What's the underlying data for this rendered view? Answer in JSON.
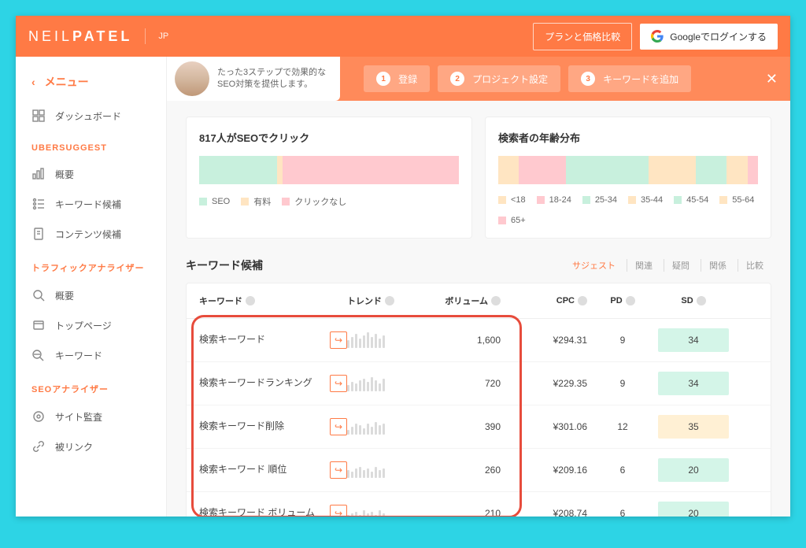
{
  "topbar": {
    "logo_light": "NEIL",
    "logo_bold": "PATEL",
    "lang": "JP",
    "plan_button": "プランと価格比較",
    "google_button": "Googleでログインする"
  },
  "sidebar": {
    "menu_label": "メニュー",
    "dashboard": "ダッシュボード",
    "section_ubersuggest": "UBERSUGGEST",
    "overview": "概要",
    "keyword_ideas": "キーワード候補",
    "content_ideas": "コンテンツ候補",
    "section_traffic": "トラフィックアナライザー",
    "traffic_overview": "概要",
    "top_pages": "トップページ",
    "keywords": "キーワード",
    "section_seo": "SEOアナライザー",
    "site_audit": "サイト監査",
    "backlinks": "被リンク"
  },
  "promo": {
    "line1": "たった3ステップで効果的な",
    "line2": "SEO対策を提供します。",
    "step1": "登録",
    "step2": "プロジェクト設定",
    "step3": "キーワードを追加"
  },
  "card_clicks": {
    "title": "817人がSEOでクリック",
    "legend": [
      "SEO",
      "有料",
      "クリックなし"
    ],
    "colors": [
      "#c8f0dd",
      "#ffe5c2",
      "#ffc9cf"
    ],
    "segments": [
      30,
      2,
      68
    ]
  },
  "card_age": {
    "title": "検索者の年齢分布",
    "legend": [
      "<18",
      "18-24",
      "25-34",
      "35-44",
      "45-54",
      "55-64",
      "65+"
    ],
    "colors": [
      "#ffe5c2",
      "#ffc9cf",
      "#c8f0dd",
      "#ffe5c2",
      "#c8f0dd",
      "#ffe5c2",
      "#ffc9cf"
    ],
    "segments": [
      8,
      18,
      32,
      18,
      12,
      8,
      4
    ]
  },
  "keyword_section": {
    "title": "キーワード候補",
    "tabs": [
      "サジェスト",
      "関連",
      "疑問",
      "関係",
      "比較"
    ]
  },
  "table": {
    "headers": {
      "keyword": "キーワード",
      "trend": "トレンド",
      "volume": "ボリューム",
      "cpc": "CPC",
      "pd": "PD",
      "sd": "SD"
    },
    "rows": [
      {
        "keyword": "検索キーワード",
        "volume": "1,600",
        "cpc": "¥294.31",
        "pd": "9",
        "sd": "34",
        "sd_class": "sd-green"
      },
      {
        "keyword": "検索キーワードランキング",
        "volume": "720",
        "cpc": "¥229.35",
        "pd": "9",
        "sd": "34",
        "sd_class": "sd-green"
      },
      {
        "keyword": "検索キーワード削除",
        "volume": "390",
        "cpc": "¥301.06",
        "pd": "12",
        "sd": "35",
        "sd_class": "sd-yellow"
      },
      {
        "keyword": "検索キーワード 順位",
        "volume": "260",
        "cpc": "¥209.16",
        "pd": "6",
        "sd": "20",
        "sd_class": "sd-green"
      },
      {
        "keyword": "検索キーワード ボリューム",
        "volume": "210",
        "cpc": "¥208.74",
        "pd": "6",
        "sd": "20",
        "sd_class": "sd-green"
      }
    ]
  },
  "chart_data": [
    {
      "type": "bar",
      "title": "817人がSEOでクリック",
      "categories": [
        "SEO",
        "有料",
        "クリックなし"
      ],
      "values": [
        30,
        2,
        68
      ]
    },
    {
      "type": "bar",
      "title": "検索者の年齢分布",
      "categories": [
        "<18",
        "18-24",
        "25-34",
        "35-44",
        "45-54",
        "55-64",
        "65+"
      ],
      "values": [
        8,
        18,
        32,
        18,
        12,
        8,
        4
      ]
    }
  ]
}
